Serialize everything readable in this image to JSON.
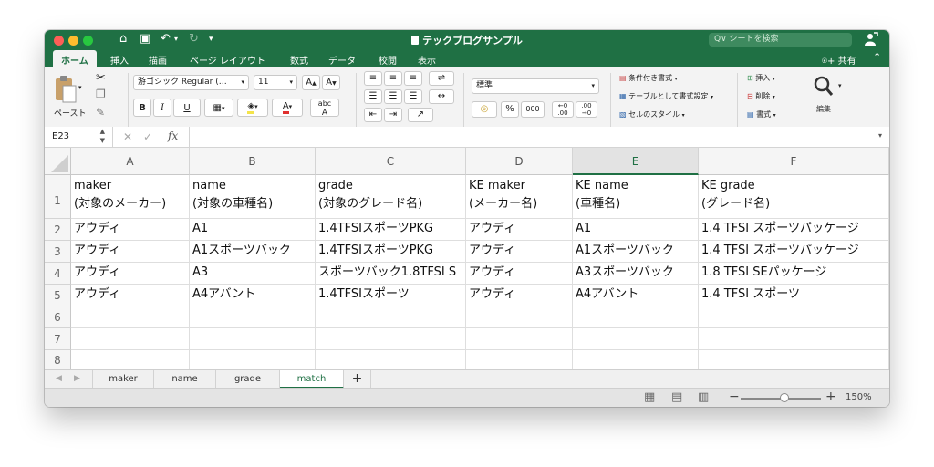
{
  "titlebar": {
    "title": "テックブログサンプル",
    "search_placeholder": "Q∨ シートを検索"
  },
  "tabs": [
    "ホーム",
    "挿入",
    "描画",
    "ページ レイアウト",
    "数式",
    "データ",
    "校閲",
    "表示"
  ],
  "share_label": "共有",
  "ribbon": {
    "paste_label": "ペースト",
    "font_name": "游ゴシック Regular (…",
    "font_size": "11",
    "bold": "B",
    "italic": "I",
    "underline": "U",
    "font_color_letter": "A",
    "grow_font": "A",
    "shrink_font": "A",
    "phonetic": "abc",
    "number_format": "標準",
    "percent": "%",
    "comma": "000",
    "conditional_format": "条件付き書式",
    "format_as_table": "テーブルとして書式設定",
    "cell_styles": "セルのスタイル",
    "insert": "挿入",
    "delete": "削除",
    "format": "書式",
    "edit": "編集"
  },
  "formula_bar": {
    "name_box": "E23",
    "fx": "fx",
    "content": ""
  },
  "sheet": {
    "columns": [
      "A",
      "B",
      "C",
      "D",
      "E",
      "F"
    ],
    "rows": [
      "1",
      "2",
      "3",
      "4",
      "5",
      "6",
      "7",
      "8"
    ],
    "header_row": [
      [
        "maker",
        "(対象のメーカー)"
      ],
      [
        "name",
        "(対象の車種名)"
      ],
      [
        "grade",
        "(対象のグレード名)"
      ],
      [
        "KE maker",
        "(メーカー名)"
      ],
      [
        "KE name",
        "(車種名)"
      ],
      [
        "KE grade",
        "(グレード名)"
      ]
    ],
    "data": [
      [
        "アウディ",
        "A1",
        "1.4TFSIスポーツPKG",
        "アウディ",
        "A1",
        "1.4 TFSI スポーツパッケージ"
      ],
      [
        "アウディ",
        "A1スポーツバック",
        "1.4TFSIスポーツPKG",
        "アウディ",
        "A1スポーツバック",
        "1.4 TFSI スポーツパッケージ"
      ],
      [
        "アウディ",
        "A3",
        "スポーツバック1.8TFSI S",
        "アウディ",
        "A3スポーツバック",
        "1.8 TFSI SEパッケージ"
      ],
      [
        "アウディ",
        "A4アバント",
        "1.4TFSIスポーツ",
        "アウディ",
        "A4アバント",
        "1.4 TFSI スポーツ"
      ],
      [
        "",
        "",
        "",
        "",
        "",
        ""
      ],
      [
        "",
        "",
        "",
        "",
        "",
        ""
      ],
      [
        "",
        "",
        "",
        "",
        "",
        ""
      ]
    ]
  },
  "sheet_tabs": [
    "maker",
    "name",
    "grade",
    "match"
  ],
  "active_sheet": "match",
  "status": {
    "zoom": "150%"
  },
  "colors": {
    "accent": "#1f7044"
  }
}
